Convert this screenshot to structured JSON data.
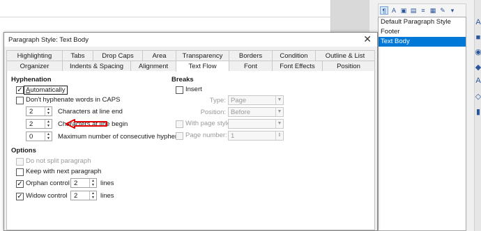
{
  "dialog": {
    "title": "Paragraph Style: Text Body",
    "close_glyph": "✕",
    "tabs_row1": [
      "Highlighting",
      "Tabs",
      "Drop Caps",
      "Area",
      "Transparency",
      "Borders",
      "Condition",
      "Outline & List"
    ],
    "tabs_row2": [
      "Organizer",
      "Indents & Spacing",
      "Alignment",
      "Text Flow",
      "Font",
      "Font Effects",
      "Position"
    ],
    "active_tab": "Text Flow"
  },
  "hyphenation": {
    "title": "Hyphenation",
    "automatically": {
      "label": "Automatically",
      "checked": true
    },
    "dont_caps": {
      "label": "Don't hyphenate words in CAPS",
      "checked": false
    },
    "chars_end": {
      "value": "2",
      "label": "Characters at line end"
    },
    "chars_begin": {
      "value": "2",
      "label": "Characters at line begin"
    },
    "max_hyphens": {
      "value": "0",
      "label": "Maximum number of consecutive hyphens"
    }
  },
  "options": {
    "title": "Options",
    "do_not_split": {
      "label": "Do not split paragraph",
      "checked": false
    },
    "keep_with_next": {
      "label": "Keep with next paragraph",
      "checked": false
    },
    "orphan": {
      "label": "Orphan control",
      "value": "2",
      "unit": "lines",
      "checked": true
    },
    "widow": {
      "label": "Widow control",
      "value": "2",
      "unit": "lines",
      "checked": true
    }
  },
  "breaks": {
    "title": "Breaks",
    "insert": {
      "label": "Insert",
      "checked": false
    },
    "type": {
      "label": "Type:",
      "value": "Page"
    },
    "position": {
      "label": "Position:",
      "value": "Before"
    },
    "with_page_style": {
      "label": "With page style:",
      "value": ""
    },
    "page_number": {
      "label": "Page number:",
      "value": "1"
    }
  },
  "styles_panel": {
    "items": [
      "Default Paragraph Style",
      "Footer",
      "Text Body"
    ],
    "selected": "Text Body"
  },
  "colors": {
    "accent": "#0078d7",
    "arrow": "#e00000"
  }
}
